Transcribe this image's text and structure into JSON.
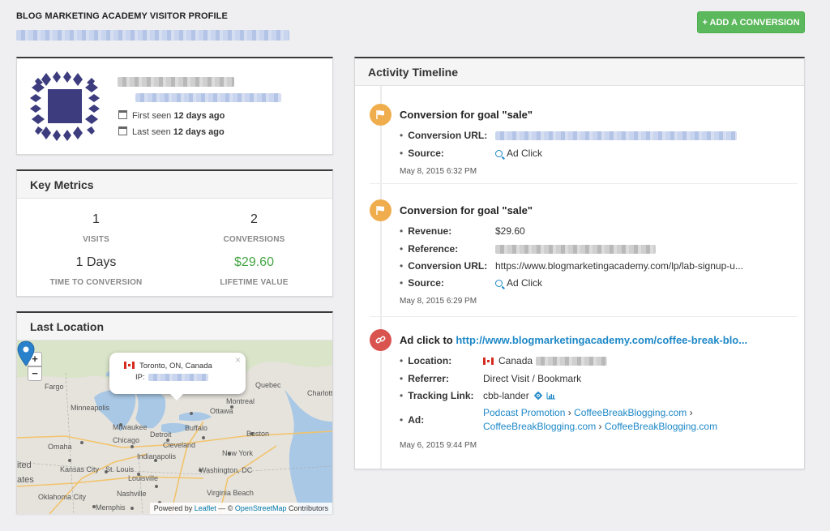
{
  "header": {
    "title": "BLOG MARKETING ACADEMY VISITOR PROFILE",
    "add_button": "+ ADD A CONVERSION"
  },
  "profile": {
    "first_seen_prefix": "First seen ",
    "first_seen_value": "12 days ago",
    "last_seen_prefix": "Last seen ",
    "last_seen_value": "12 days ago"
  },
  "metrics": {
    "title": "Key Metrics",
    "visits": {
      "value": "1",
      "label": "VISITS"
    },
    "conversions": {
      "value": "2",
      "label": "CONVERSIONS"
    },
    "time_to_conversion": {
      "value": "1 Days",
      "label": "TIME TO CONVERSION"
    },
    "lifetime_value": {
      "value": "$29.60",
      "label": "LIFETIME VALUE",
      "color": "#46a546"
    }
  },
  "location": {
    "title": "Last Location",
    "zoom_in": "+",
    "zoom_out": "−",
    "popup_location": "Toronto, ON, Canada",
    "popup_ip_label": "IP:",
    "popup_close": "×",
    "cities": [
      "Fargo",
      "Minneapolis",
      "Milwaukee",
      "Chicago",
      "Detroit",
      "Omaha",
      "Indianapolis",
      "Kansas City",
      "St. Louis",
      "Louisville",
      "Oklahoma City",
      "Memphis",
      "Nashville",
      "Montreal",
      "Boston",
      "New York",
      "Buffalo",
      "Cleveland",
      "Washington, DC",
      "Virginia Beach",
      "Quebec",
      "Charlotte",
      "Ottawa",
      "ited",
      "ates"
    ],
    "attribution": {
      "powered_by": "Powered by ",
      "leaflet": "Leaflet",
      "sep": " — © ",
      "osm": "OpenStreetMap",
      "contributors": " Contributors"
    }
  },
  "timeline": {
    "title": "Activity Timeline",
    "entries": [
      {
        "title": "Conversion for goal \"sale\"",
        "rows": [
          {
            "key": "Conversion URL:"
          },
          {
            "key": "Source:",
            "value": "Ad Click"
          }
        ],
        "date": "May 8, 2015 6:32 PM",
        "icon": "flag-icon",
        "color": "#f0ad4e"
      },
      {
        "title": "Conversion for goal \"sale\"",
        "rows": [
          {
            "key": "Revenue:",
            "value": "$29.60"
          },
          {
            "key": "Reference:"
          },
          {
            "key": "Conversion URL:",
            "value": "https://www.blogmarketingacademy.com/lp/lab-signup-u..."
          },
          {
            "key": "Source:",
            "value": "Ad Click"
          }
        ],
        "date": "May 8, 2015 6:29 PM",
        "icon": "flag-icon",
        "color": "#f0ad4e"
      },
      {
        "title_prefix": "Ad click to ",
        "title_link": "http://www.blogmarketingacademy.com/coffee-break-blo...",
        "rows": [
          {
            "key": "Location:",
            "value": "Canada"
          },
          {
            "key": "Referrer:",
            "value": "Direct Visit / Bookmark"
          },
          {
            "key": "Tracking Link:",
            "value": "cbb-lander"
          },
          {
            "key": "Ad:",
            "value_parts": [
              "Podcast Promotion",
              " › ",
              "CoffeeBreakBlogging.com",
              " ›",
              "CoffeeBreakBlogging.com",
              " › ",
              "CoffeeBreakBlogging.com"
            ]
          }
        ],
        "date": "May 6, 2015 9:44 PM",
        "icon": "link-icon",
        "color": "#d9534f"
      }
    ]
  }
}
